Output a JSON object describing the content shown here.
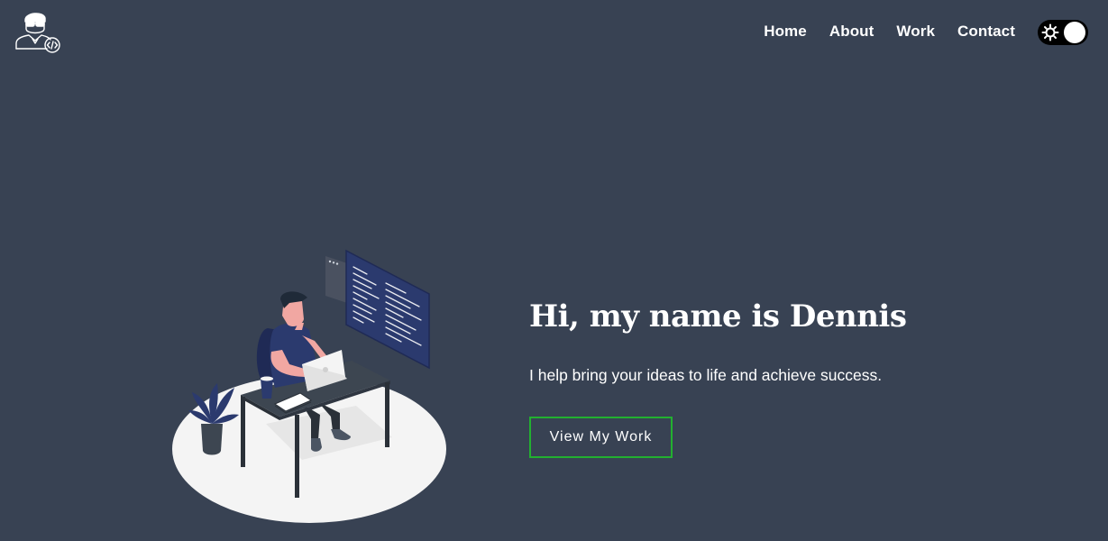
{
  "header": {
    "logo_icon": "developer-avatar-logo-icon",
    "nav": [
      {
        "label": "Home"
      },
      {
        "label": "About"
      },
      {
        "label": "Work"
      },
      {
        "label": "Contact"
      }
    ],
    "theme_toggle": {
      "icon": "sun-icon",
      "state": "dark"
    }
  },
  "hero": {
    "title": "Hi, my name is Dennis",
    "subtitle": "I help bring your ideas to life and achieve success.",
    "cta_label": "View My Work",
    "illustration_icon": "developer-at-desk-illustration"
  },
  "colors": {
    "background": "#384253",
    "text": "#ffffff",
    "cta_border": "#22b030",
    "toggle_track": "#000000"
  }
}
